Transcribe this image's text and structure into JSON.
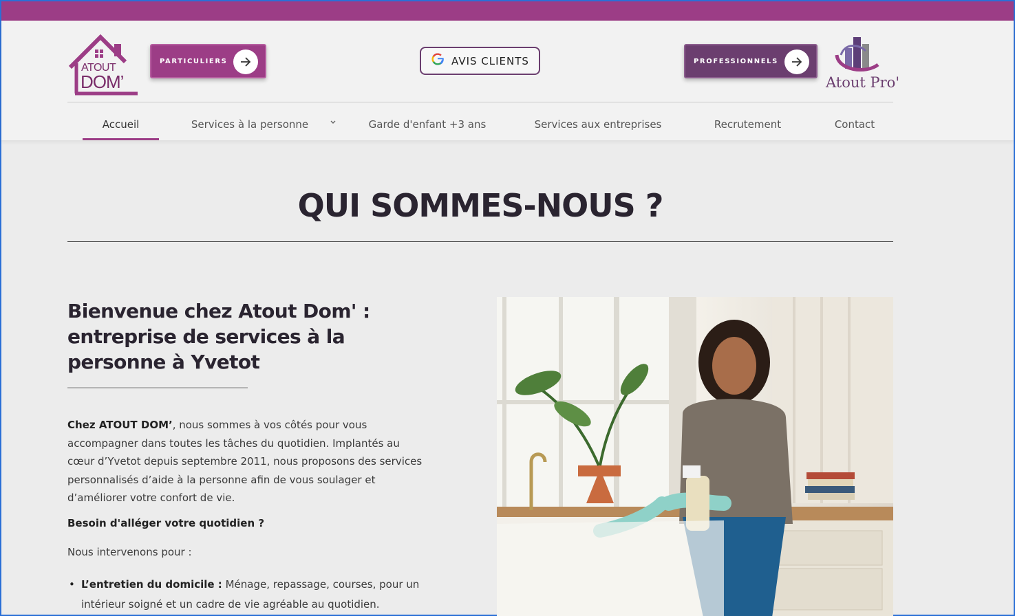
{
  "logo": {
    "line1": "ATOUT",
    "line2": "DOM’"
  },
  "header": {
    "particuliers_label": "PARTICULIERS",
    "avis_label": "AVIS CLIENTS",
    "google_letter": "G",
    "professionnels_label": "PROFESSIONNELS",
    "pro_logo_text": "Atout Pro'"
  },
  "nav": {
    "items": [
      {
        "label": "Accueil",
        "active": true
      },
      {
        "label": "Services à la personne"
      },
      {
        "label": "Garde d'enfant +3 ans"
      },
      {
        "label": "Services aux entreprises"
      },
      {
        "label": "Recrutement"
      },
      {
        "label": "Contact"
      }
    ],
    "dropdown_glyph": "⌄"
  },
  "main": {
    "title": "QUI SOMMES-NOUS ?",
    "welcome_title": "Bienvenue chez Atout Dom' : entreprise de services à la personne à Yvetot",
    "intro_bold": "Chez ATOUT DOM’",
    "intro_text": ", nous sommes à vos côtés pour vous accompagner dans toutes les tâches du quotidien. Implantés au cœur d’Yvetot depuis septembre 2011, nous proposons des services personnalisés d’aide à la personne afin de vous soulager et d’améliorer votre confort de vie.",
    "besoin": "Besoin d'alléger votre quotidien ?",
    "intervenons": "Nous intervenons pour :",
    "bullet_bold": "L’entretien du domicile :",
    "bullet_text": " Ménage, repassage, courses, pour un intérieur soigné et un cadre de vie agréable au quotidien."
  },
  "colors": {
    "brand_purple": "#9c3d86",
    "pro_purple": "#6b3e6f",
    "text_dark": "#2a2430"
  },
  "icons": [
    "house-logo-icon",
    "arrow-right-icon",
    "google-icon",
    "chevron-down-icon",
    "building-logo-icon"
  ]
}
